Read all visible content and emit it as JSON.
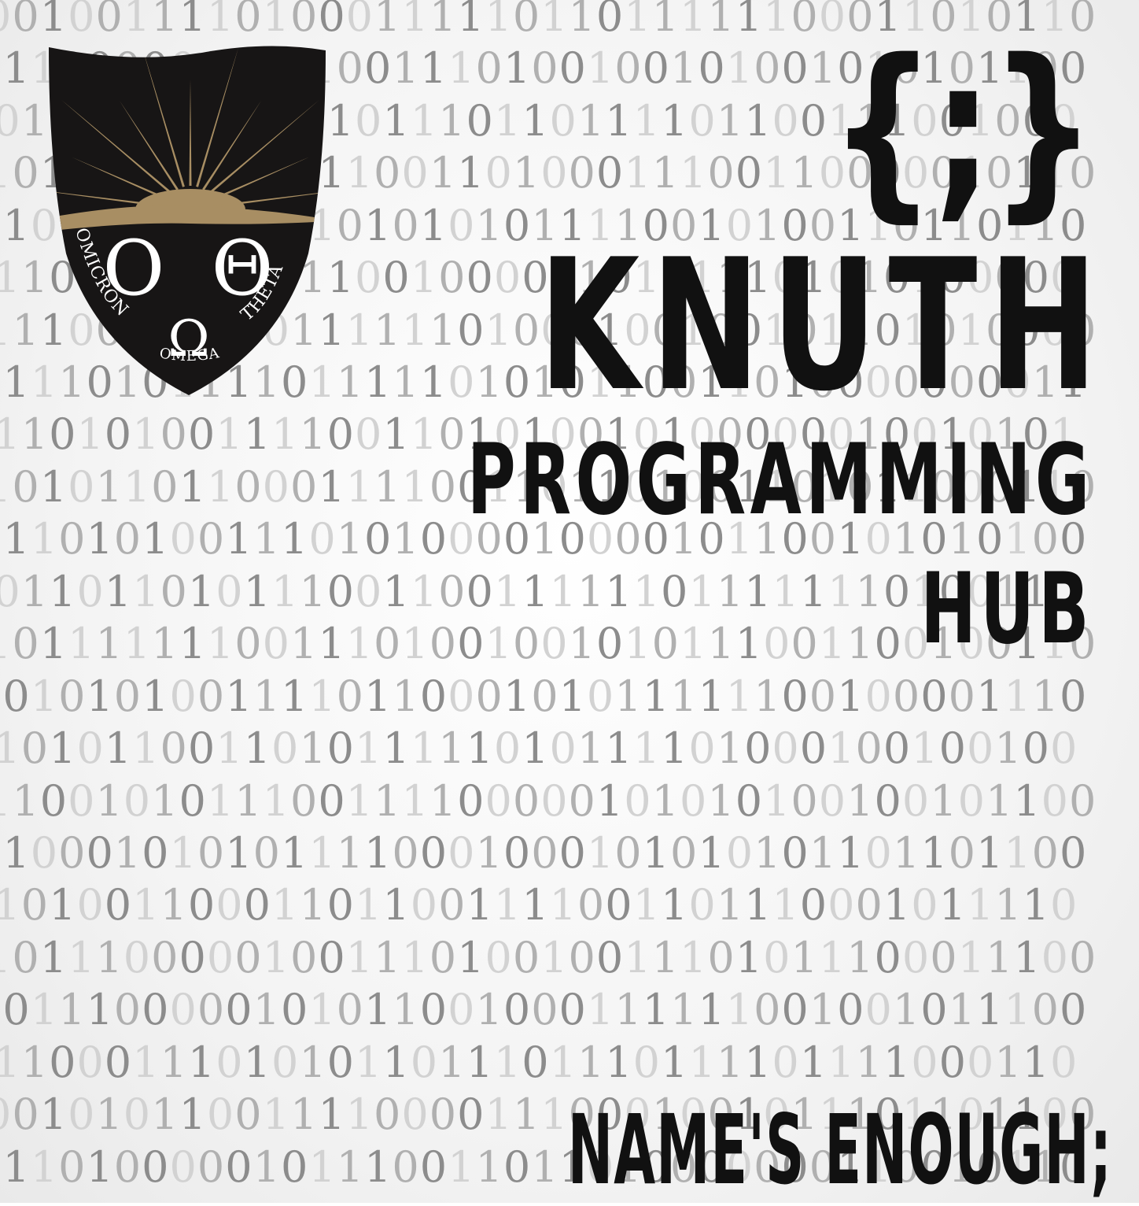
{
  "background": {
    "binary_rows": [
      "0010011110100011111011011111100011010110",
      "0110000010111001110100100101001010101100",
      "0011001101110101110110111101100111001000",
      "1011000010111100110100011100110000010110",
      "0101111101101010101011110010100110110110",
      "0110000001001100100000101011101010100000",
      "1110001011011111101000100100101101010000",
      "1111010111101111101010110011010000000011",
      "1110101001111001101010010100000010010101",
      "1010110110001111001101101001101011000110",
      "0110101001110101000010000101100101010100",
      "1011011010111001100111111011111110100110",
      "1011111110011101001001010111001100100110",
      "1010101001111011000101011111100100001110",
      "1101011001101011111010111101000100100100",
      "1100101011100111100000101010100100101100",
      "1100010101011110001000101010101101101100",
      "1101001100011011001111001101110001011110",
      "1011100000100111010010011101011100011100",
      "1011100000101011001000111111001001011100",
      "0110001110101011011101110111101111000110",
      "0010101100111100001110001001011101101100",
      "1110100000101110011011010000000110010110"
    ],
    "colors": [
      "#d2d2d2",
      "#b0b0b0",
      "#8c8c8c"
    ]
  },
  "logo": {
    "symbols": [
      "Ο",
      "Ω",
      "Θ"
    ],
    "arc_left": "OMICRON",
    "arc_right": "THETA",
    "arc_bottom": "OMEGA",
    "colors": {
      "shield": "#171515",
      "sun": "#a88e63",
      "text": "#ffffff"
    }
  },
  "headline": {
    "glyph": "{;}",
    "title": "KNUTH",
    "subtitle_line1": "PROGRAMMING",
    "subtitle_line2": "HUB",
    "tagline": "NAME'S ENOUGH;",
    "color": "#111111"
  }
}
